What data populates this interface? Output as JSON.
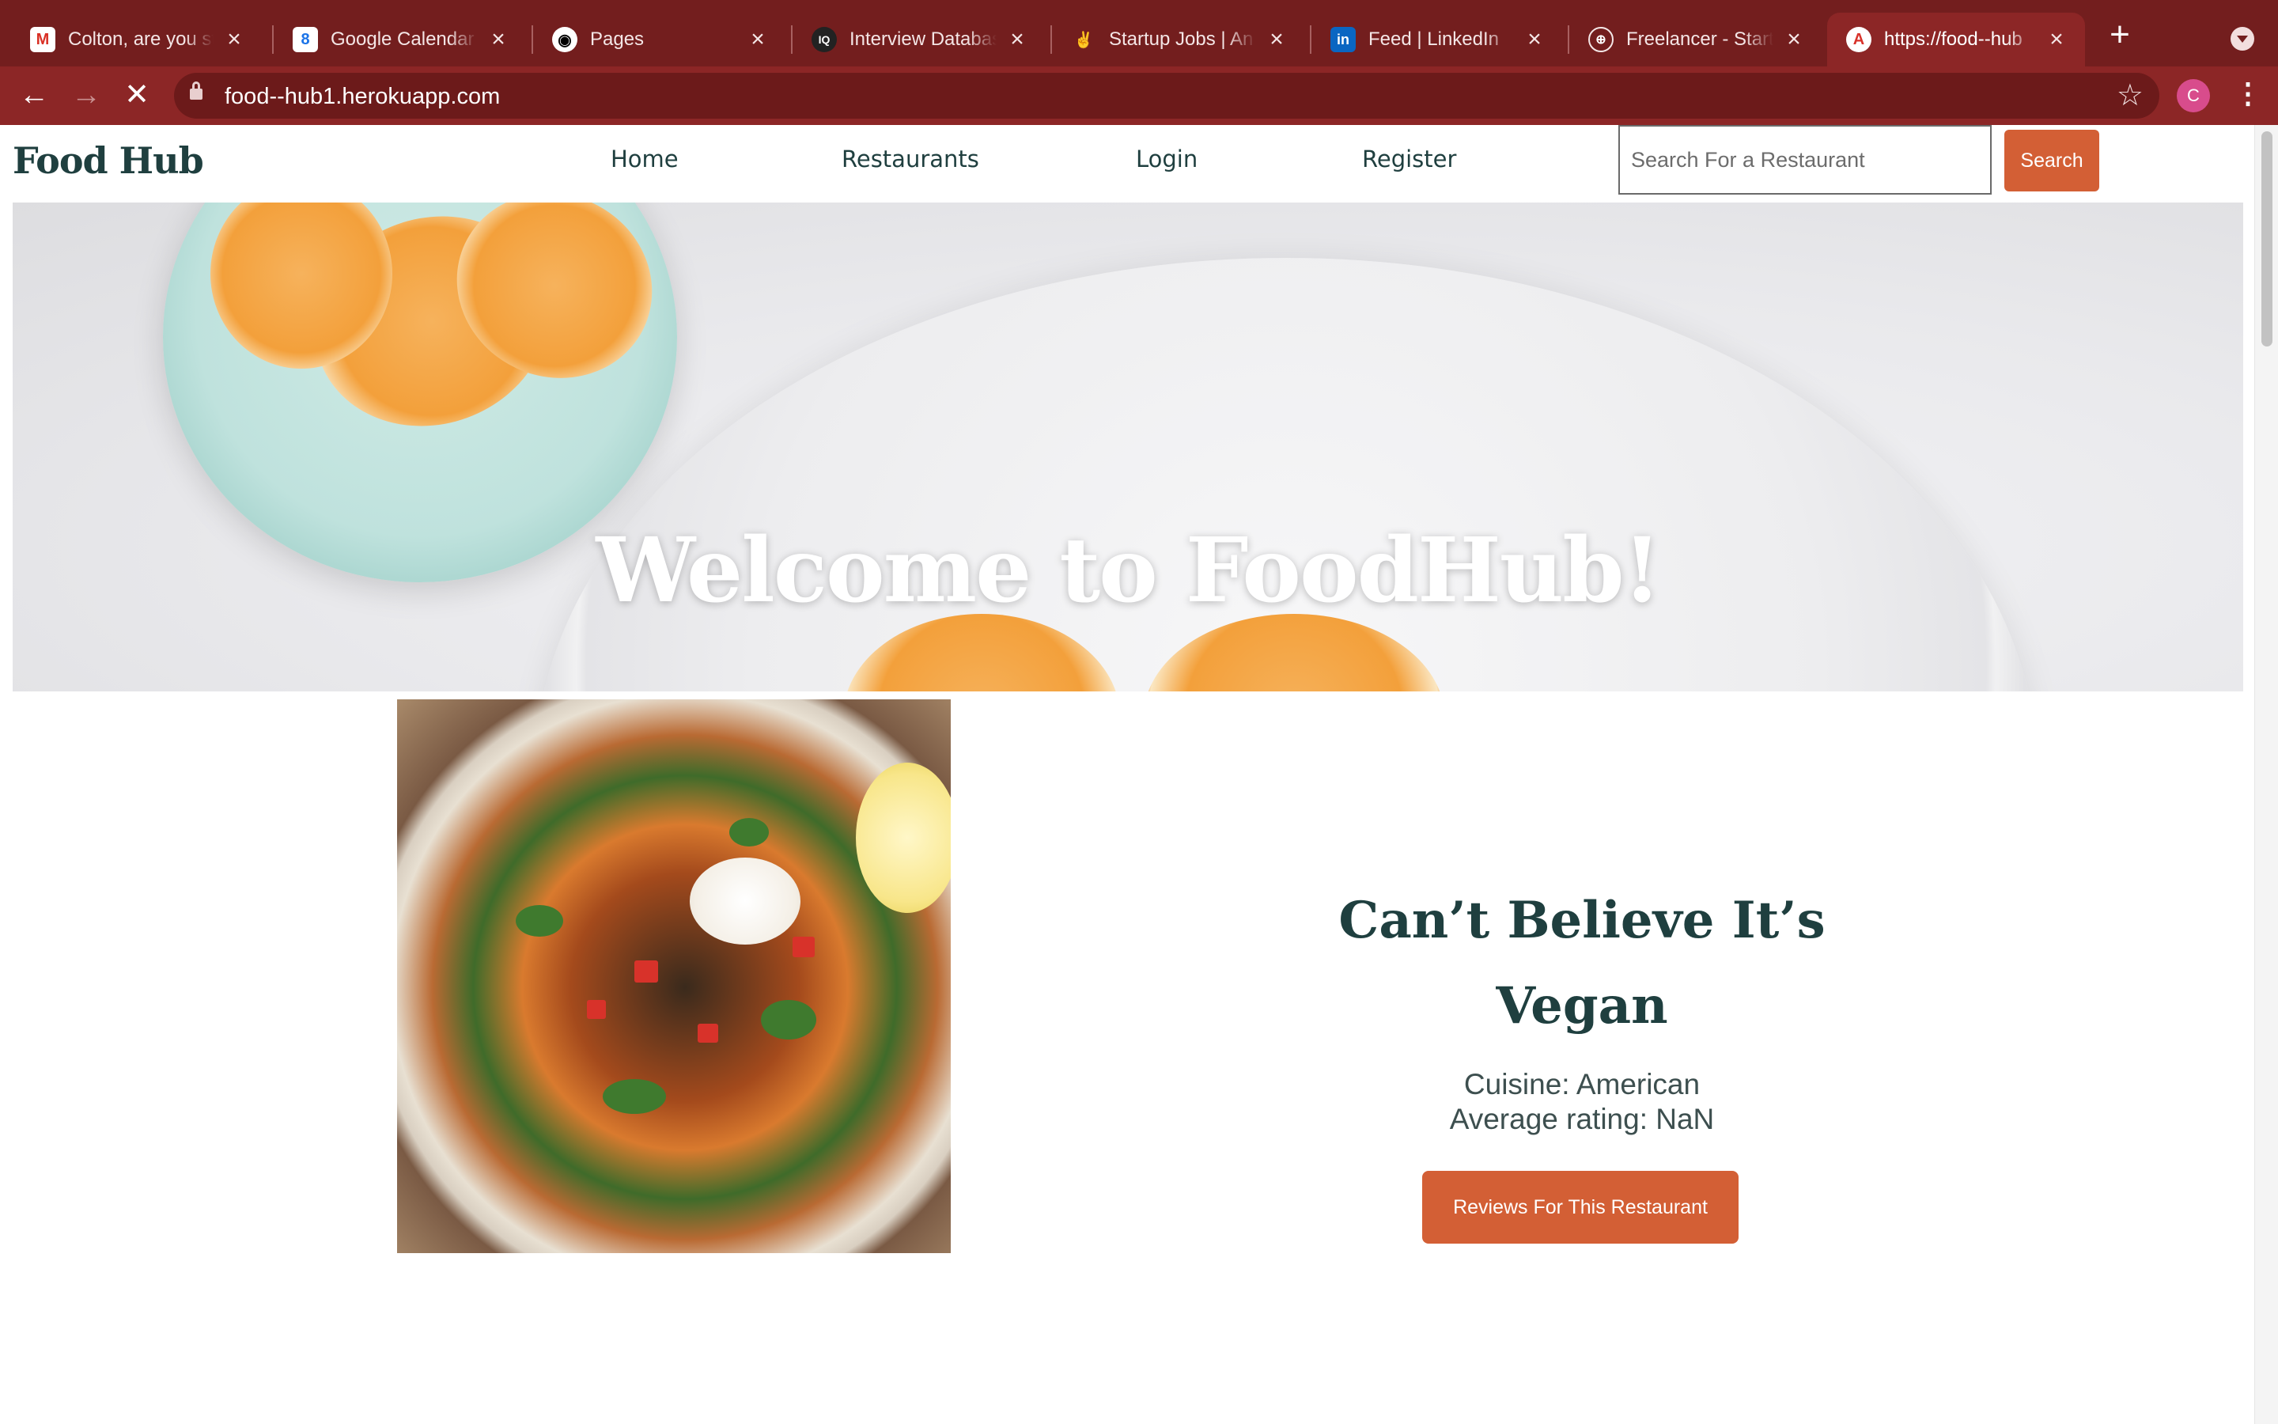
{
  "browser": {
    "tabs": [
      {
        "title": "Colton, are you st",
        "icon": "gmail-icon",
        "active": false
      },
      {
        "title": "Google Calendar",
        "icon": "calendar-icon",
        "active": false
      },
      {
        "title": "Pages",
        "icon": "github-icon",
        "active": false
      },
      {
        "title": "Interview Databas",
        "icon": "interview-icon",
        "active": false
      },
      {
        "title": "Startup Jobs | An",
        "icon": "angellist-icon",
        "active": false
      },
      {
        "title": "Feed | LinkedIn",
        "icon": "linkedin-icon",
        "active": false
      },
      {
        "title": "Freelancer - Start",
        "icon": "globe-icon",
        "active": false
      },
      {
        "title": "https://food--hub",
        "icon": "angular-icon",
        "active": true
      }
    ],
    "address": "food--hub1.herokuapp.com",
    "profile_initial": "C",
    "colors": {
      "frame": "#731e1e",
      "toolbar": "#8c2626"
    }
  },
  "site": {
    "brand": "Food Hub",
    "nav": {
      "home": "Home",
      "restaurants": "Restaurants",
      "login": "Login",
      "register": "Register"
    },
    "search": {
      "placeholder": "Search For a Restaurant",
      "button": "Search"
    },
    "accent_color": "#d35f35"
  },
  "hero": {
    "title": "Welcome to FoodHub!"
  },
  "restaurant": {
    "name": "Can’t Believe It’s Vegan",
    "cuisine_line": "Cuisine: American",
    "rating_line": "Average rating: NaN",
    "reviews_button": "Reviews For This Restaurant"
  }
}
